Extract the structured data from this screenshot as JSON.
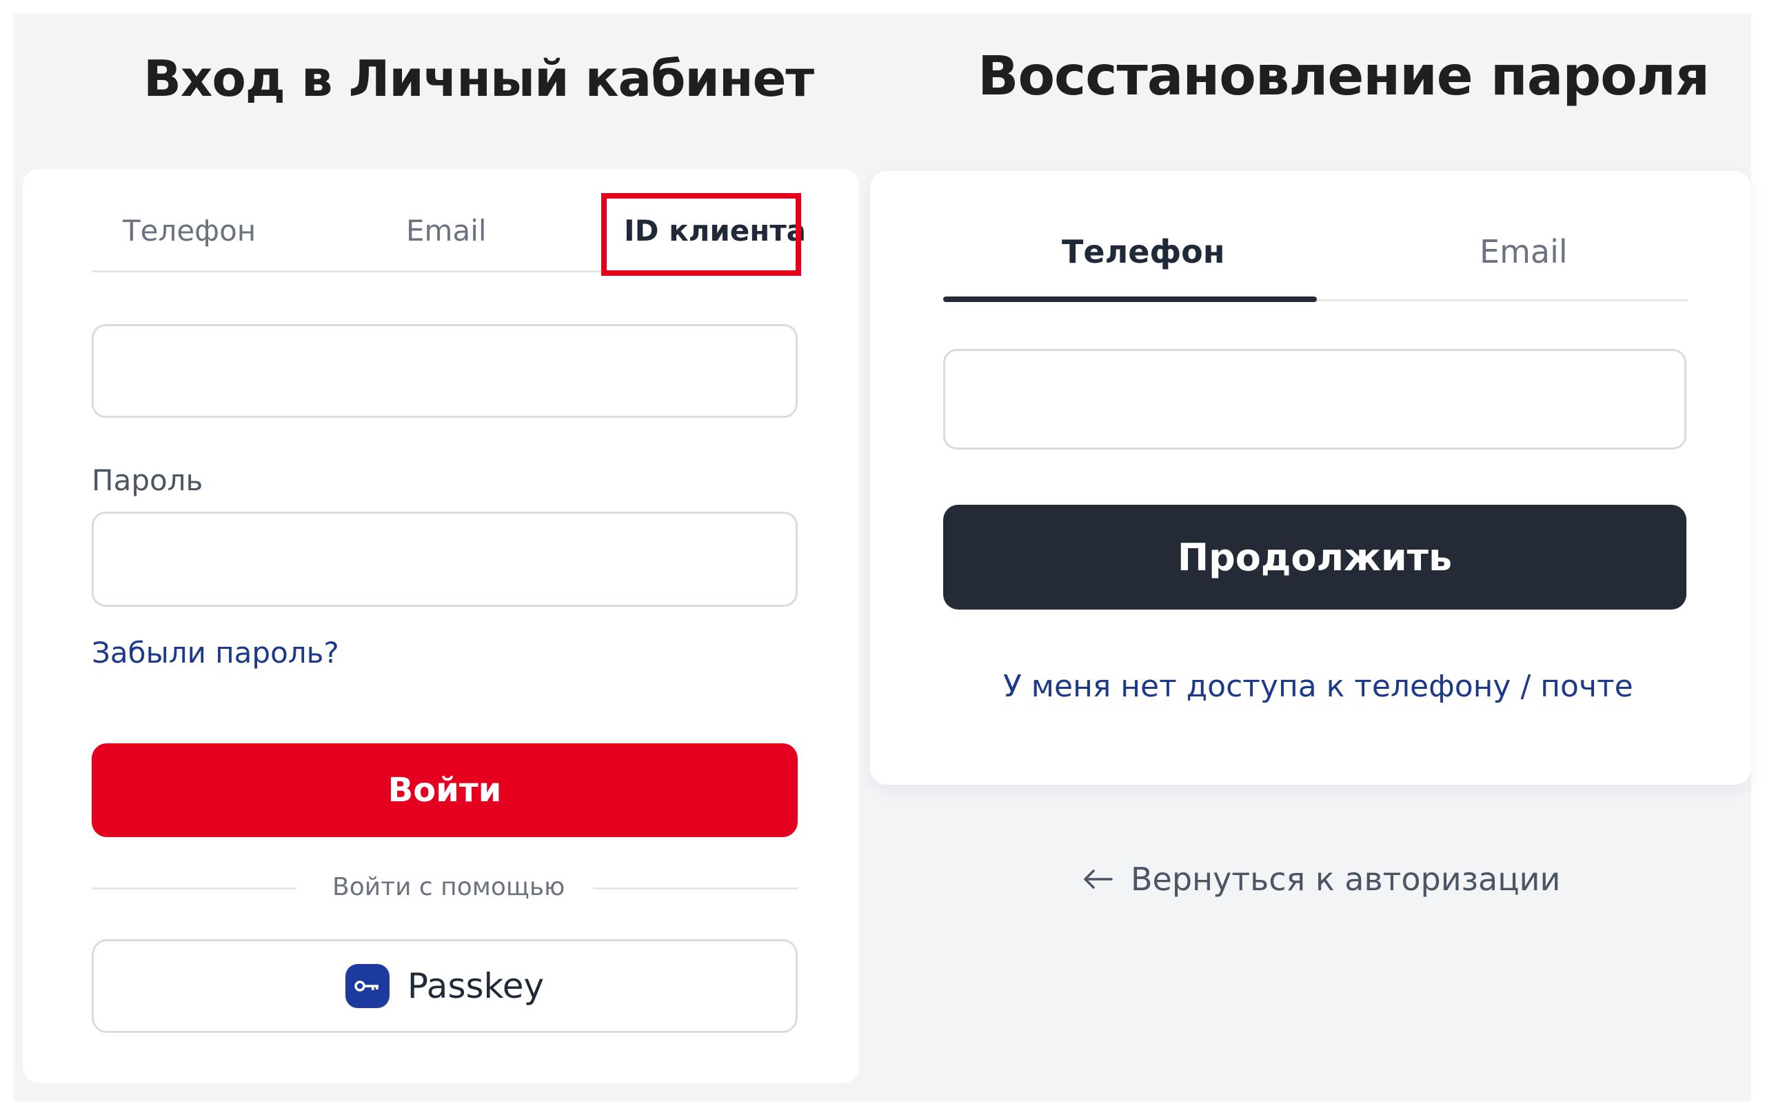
{
  "login": {
    "title": "Вход в Личный кабинет",
    "tabs": [
      {
        "label": "Телефон",
        "active": false
      },
      {
        "label": "Email",
        "active": false
      },
      {
        "label": "ID клиента",
        "active": true
      }
    ],
    "id_field": {
      "value": "",
      "placeholder": ""
    },
    "password_label": "Пароль",
    "password_field": {
      "value": "",
      "placeholder": ""
    },
    "forgot_link": "Забыли пароль?",
    "submit_label": "Войти",
    "divider_text": "Войти с помощью",
    "passkey_label": "Passkey"
  },
  "recovery": {
    "title": "Восстановление пароля",
    "tabs": [
      {
        "label": "Телефон",
        "active": true
      },
      {
        "label": "Email",
        "active": false
      }
    ],
    "phone_field": {
      "value": "",
      "placeholder": ""
    },
    "continue_label": "Продолжить",
    "no_access_link": "У меня нет доступа к телефону / почте",
    "back_link": "Вернуться к авторизации"
  },
  "colors": {
    "accent_red": "#e4001e",
    "dark_button": "#252b36",
    "link_blue": "#1d3a8a",
    "highlight": "#e3001b"
  },
  "icons": {
    "passkey": "key-icon",
    "back": "arrow-left-icon"
  }
}
